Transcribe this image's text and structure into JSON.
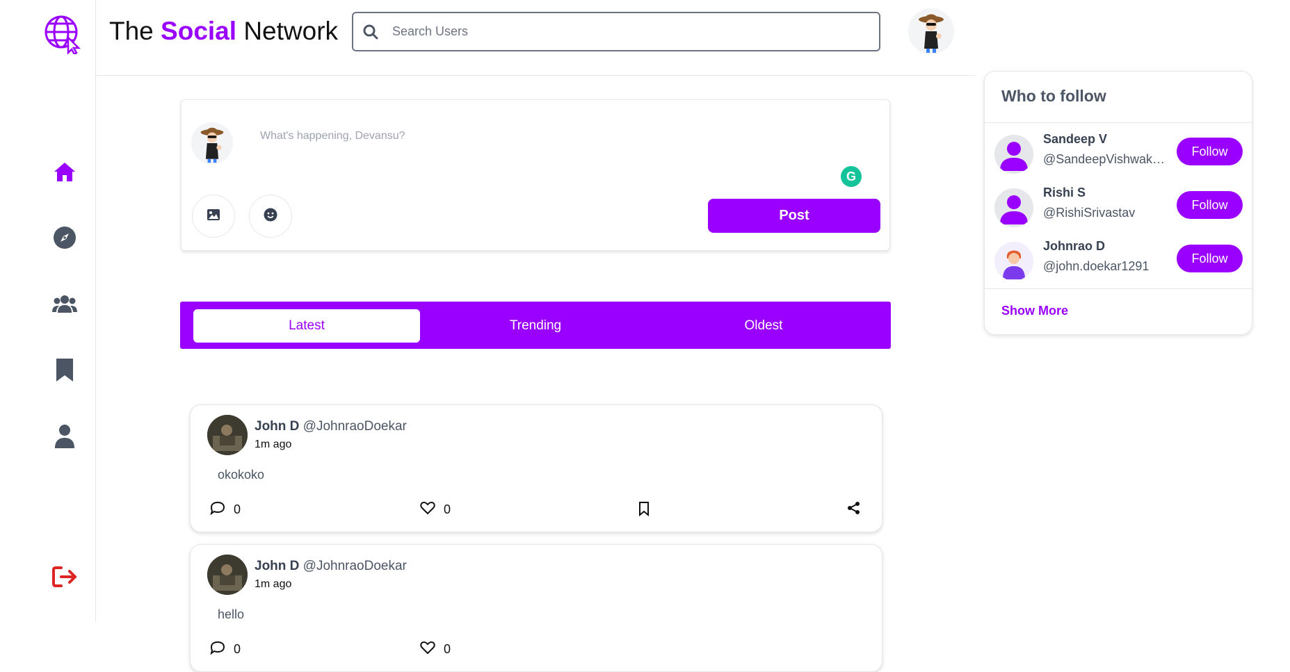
{
  "brand": {
    "prefix": "The",
    "highlight": "Social",
    "suffix": "Network"
  },
  "search": {
    "placeholder": "Search Users"
  },
  "composer": {
    "placeholder": "What's happening, Devansu?",
    "post_label": "Post"
  },
  "tabs": [
    {
      "label": "Latest",
      "active": true
    },
    {
      "label": "Trending",
      "active": false
    },
    {
      "label": "Oldest",
      "active": false
    }
  ],
  "posts": [
    {
      "name": "John D",
      "handle": "@JohnraoDoekar",
      "time": "1m ago",
      "text": "okokoko",
      "comments": "0",
      "likes": "0"
    },
    {
      "name": "John D",
      "handle": "@JohnraoDoekar",
      "time": "1m ago",
      "text": "hello",
      "comments": "0",
      "likes": "0"
    }
  ],
  "who_to_follow": {
    "title": "Who to follow",
    "users": [
      {
        "name": "Sandeep V",
        "handle": "@SandeepVishwakarma",
        "button": "Follow"
      },
      {
        "name": "Rishi S",
        "handle": "@RishiSrivastav",
        "button": "Follow"
      },
      {
        "name": "Johnrao D",
        "handle": "@john.doekar1291",
        "button": "Follow"
      }
    ],
    "show_more": "Show More"
  },
  "colors": {
    "accent": "#9900ff",
    "logout": "#dc2626",
    "nav_icon": "#4b5563"
  },
  "icons": {
    "logo": "globe-cursor-icon",
    "nav": [
      "home-icon",
      "explore-compass-icon",
      "users-icon",
      "bookmark-icon",
      "profile-icon"
    ],
    "logout": "logout-icon"
  }
}
